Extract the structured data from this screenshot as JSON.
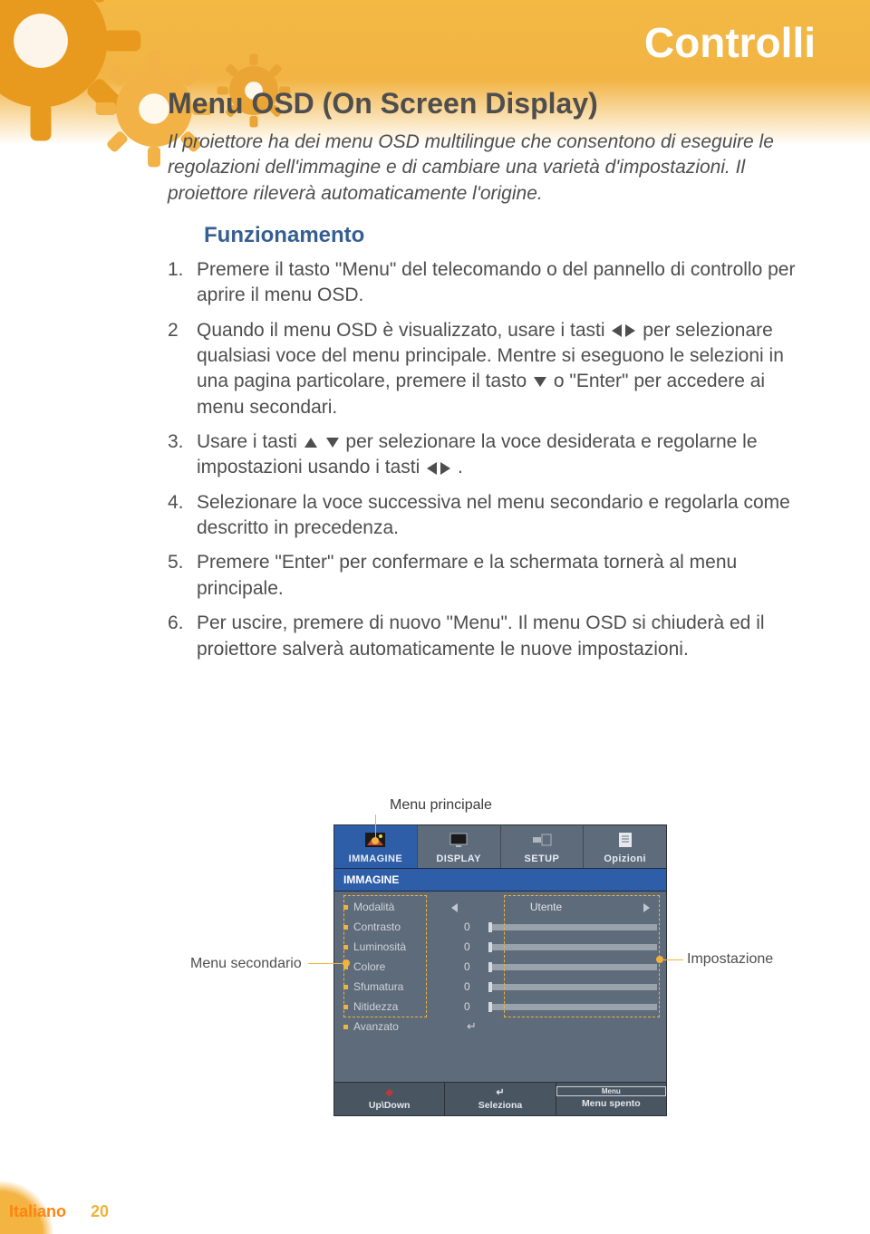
{
  "header": {
    "title": "Controlli"
  },
  "h1": "Menu OSD (On Screen Display)",
  "intro": "Il proiettore ha dei menu OSD multilingue che consentono di eseguire le regolazioni dell'immagine e di cambiare una varietà d'impostazioni. Il proiettore rileverà automaticamente l'origine.",
  "h2": "Funzionamento",
  "steps": {
    "s1": "Premere il tasto \"Menu\" del telecomando o del pannello di controllo per aprire il menu OSD.",
    "s2a": "Quando il menu OSD è visualizzato, usare i tasti ",
    "s2b": " per selezionare qualsiasi voce del menu principale. Mentre si eseguono le selezioni in una pagina particolare, premere il tasto ",
    "s2c": " o \"Enter\" per accedere ai menu secondari.",
    "s3a": "Usare i tasti ",
    "s3b": " per selezionare la voce desiderata e regolarne le impostazioni usando i tasti ",
    "s3c": ".",
    "s4": "Selezionare la voce successiva nel menu secondario e regolarla come descritto in precedenza.",
    "s5": "Premere \"Enter\" per confermare e la schermata tornerà al menu principale.",
    "s6": "Per uscire, premere di nuovo \"Menu\". Il menu OSD si chiuderà ed il proiettore salverà automaticamente le nuove impostazioni."
  },
  "figure": {
    "label_main": "Menu principale",
    "label_sub": "Menu secondario",
    "label_setting": "Impostazione",
    "tabs": [
      {
        "label": "IMMAGINE"
      },
      {
        "label": "DISPLAY"
      },
      {
        "label": "SETUP"
      },
      {
        "label": "Opizioni"
      }
    ],
    "sub_title": "IMMAGINE",
    "mode_row": {
      "name": "Modalità",
      "value": "Utente"
    },
    "rows": [
      {
        "name": "Contrasto",
        "value": "0"
      },
      {
        "name": "Luminosità",
        "value": "0"
      },
      {
        "name": "Colore",
        "value": "0"
      },
      {
        "name": "Sfumatura",
        "value": "0"
      },
      {
        "name": "Nitidezza",
        "value": "0"
      }
    ],
    "adv_row": {
      "name": "Avanzato"
    },
    "footer": [
      {
        "label": "Up\\Down"
      },
      {
        "label": "Seleziona"
      },
      {
        "label": "Menu spento"
      }
    ]
  },
  "page": {
    "lang": "Italiano",
    "num": "20"
  }
}
